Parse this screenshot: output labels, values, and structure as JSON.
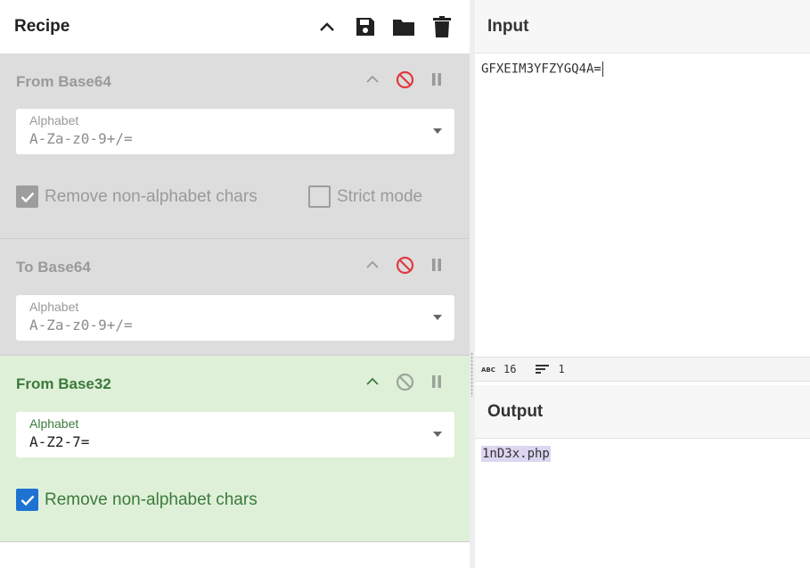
{
  "recipe": {
    "title": "Recipe",
    "operations": [
      {
        "name": "From Base64",
        "state": "disabled",
        "field_label": "Alphabet",
        "field_value": "A-Za-z0-9+/=",
        "options": [
          {
            "label": "Remove non-alphabet chars",
            "checked": true
          },
          {
            "label": "Strict mode",
            "checked": false
          }
        ]
      },
      {
        "name": "To Base64",
        "state": "disabled",
        "field_label": "Alphabet",
        "field_value": "A-Za-z0-9+/="
      },
      {
        "name": "From Base32",
        "state": "active",
        "field_label": "Alphabet",
        "field_value": "A-Z2-7=",
        "options": [
          {
            "label": "Remove non-alphabet chars",
            "checked": true
          }
        ]
      }
    ]
  },
  "input": {
    "title": "Input",
    "text": "GFXEIM3YFZYGQ4A="
  },
  "status": {
    "length_icon_text": "ABC",
    "length": "16",
    "lines": "1"
  },
  "output": {
    "title": "Output",
    "text": "1nD3x.php"
  },
  "colors": {
    "disabled_bg": "#dddddd",
    "active_bg": "#dff0d8",
    "active_text": "#3c7a3c",
    "disable_icon_red": "#e0393e",
    "checkbox_blue": "#1e73d2"
  }
}
